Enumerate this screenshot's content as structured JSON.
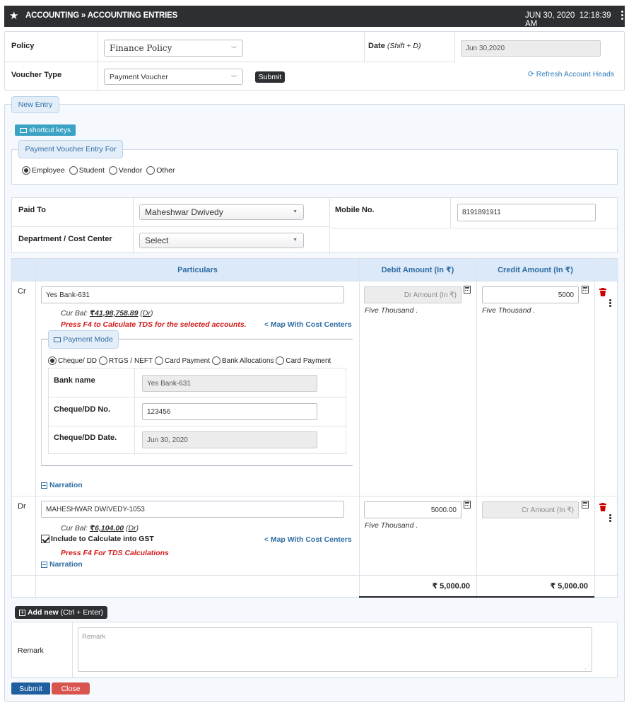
{
  "header": {
    "breadcrumb": "ACCOUNTING » ACCOUNTING ENTRIES",
    "date": "JUN 30, 2020",
    "time": "12:18:39 AM"
  },
  "form": {
    "policy_label": "Policy",
    "policy_value": "Finance Policy",
    "date_label": "Date",
    "date_hint": "(Shift + D)",
    "date_value": "Jun 30,2020",
    "voucher_type_label": "Voucher Type",
    "voucher_type_value": "Payment Voucher",
    "submit_label": "Submit",
    "refresh_label": "Refresh Account Heads"
  },
  "entry": {
    "legend": "New Entry",
    "shortcut_label": "shortcut keys",
    "for_legend": "Payment Voucher Entry For",
    "for_options": [
      "Employee",
      "Student",
      "Vendor",
      "Other"
    ],
    "for_selected": "Employee",
    "paid_to_label": "Paid To",
    "paid_to_value": "Maheshwar Dwivedy",
    "mobile_label": "Mobile No.",
    "mobile_value": "8191891911",
    "dept_label": "Department / Cost Center",
    "dept_value": "Select"
  },
  "table": {
    "col_particulars": "Particulars",
    "col_debit": "Debit Amount (In ₹)",
    "col_credit": "Credit Amount (In ₹)",
    "rows": [
      {
        "type": "Cr",
        "account": "Yes Bank-631",
        "cur_bal_label": "Cur Bal:",
        "cur_bal": "₹41,98,758.89",
        "cur_bal_side": "Dr",
        "tds_note": "Press F4 to Calculate TDS for the selected accounts.",
        "map_label": "Map With Cost Centers",
        "debit_placeholder": "Dr Amount (In ₹)",
        "debit_words": "Five Thousand .",
        "credit_value": "5000",
        "credit_words": "Five Thousand .",
        "narration": "Narration",
        "payment_mode": {
          "legend": "Payment Mode",
          "options": [
            "Cheque/ DD",
            "RTGS / NEFT",
            "Card Payment",
            "Bank Allocations",
            "Card Payment"
          ],
          "selected": "Cheque/ DD",
          "bank_label": "Bank name",
          "bank_value": "Yes Bank-631",
          "cheque_no_label": "Cheque/DD No.",
          "cheque_no_value": "123456",
          "cheque_date_label": "Cheque/DD Date.",
          "cheque_date_value": "Jun 30, 2020"
        }
      },
      {
        "type": "Dr",
        "account": "MAHESHWAR DWIVEDY-1053",
        "cur_bal_label": "Cur Bal:",
        "cur_bal": "₹6,104.00",
        "cur_bal_side": "Dr",
        "gst_label": "Include to Calculate into GST",
        "gst_checked": true,
        "tds_note": "Press F4 For TDS Calculations",
        "map_label": "Map With Cost Centers",
        "debit_value": "5000.00",
        "debit_words": "Five Thousand .",
        "credit_placeholder": "Cr Amount (In ₹)",
        "narration": "Narration"
      }
    ],
    "total_debit": "₹ 5,000.00",
    "total_credit": "₹ 5,000.00"
  },
  "footer": {
    "add_new_label": "Add new",
    "add_new_hint": "(Ctrl + Enter)",
    "remark_label": "Remark",
    "remark_placeholder": "Remark",
    "submit_label": "Submit",
    "close_label": "Close"
  },
  "colors": {
    "topbar": "#2d2f33",
    "header_blue": "#dce9f8",
    "link_blue": "#2e7ab8",
    "error_red": "#d31a1a",
    "submit_blue": "#1f5f9e",
    "close_red": "#d9534f"
  }
}
